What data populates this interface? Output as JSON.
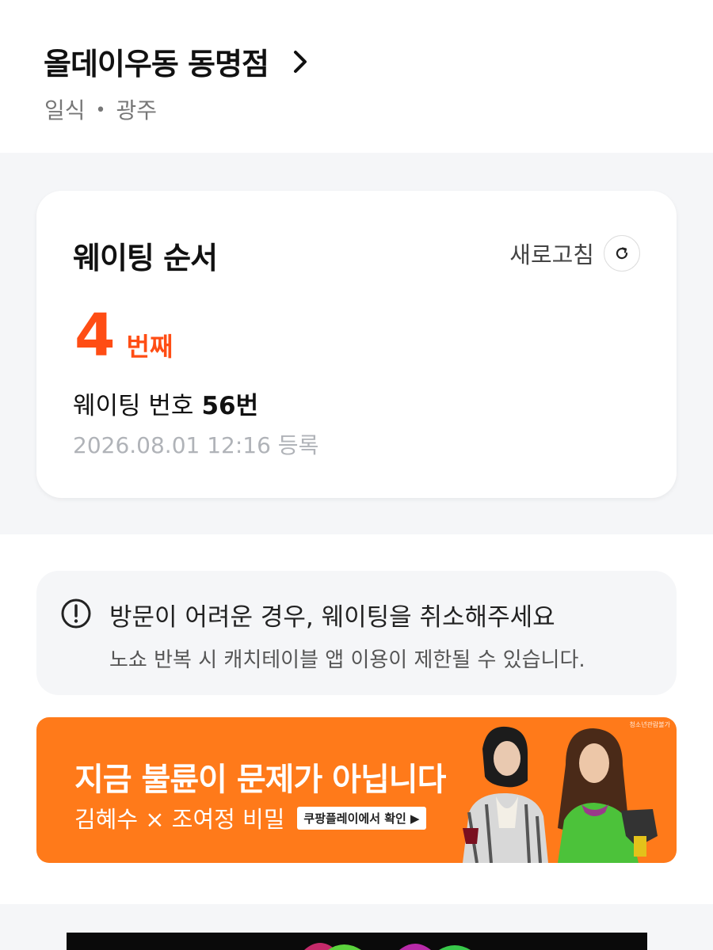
{
  "store": {
    "name": "올데이우동 동명점",
    "category": "일식",
    "region": "광주",
    "separator": "•"
  },
  "waiting": {
    "title": "웨이팅 순서",
    "refresh_label": "새로고침",
    "rank_number": "4",
    "rank_unit": "번째",
    "number_label": "웨이팅 번호",
    "number_value": "56번",
    "registered": "2026.08.01 12:16 등록",
    "accent_color": "#ff4d14"
  },
  "notice": {
    "title": "방문이 어려운 경우, 웨이팅을 취소해주세요",
    "description": "노쇼 반복 시 캐치테이블 앱 이용이 제한될 수 있습니다.",
    "icon": "exclamation-circle-icon"
  },
  "ad": {
    "headline": "지금 불륜이 문제가 아닙니다",
    "subline": "김혜수 × 조여정 비밀",
    "cta": "쿠팡플레이에서 확인 ▶",
    "rating_tag": "청소년관람불가",
    "background_color": "#ff7a1a"
  }
}
